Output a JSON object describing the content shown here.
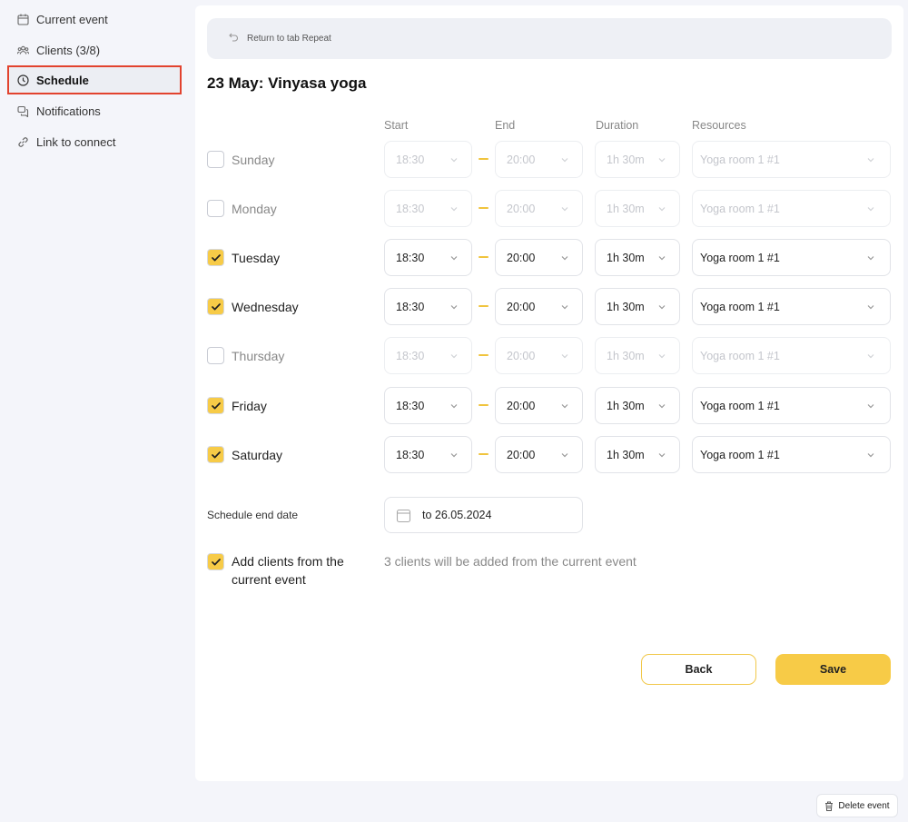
{
  "sidebar": {
    "items": [
      {
        "label": "Current event",
        "icon": "calendar-icon"
      },
      {
        "label": "Clients (3/8)",
        "icon": "users-icon"
      },
      {
        "label": "Schedule",
        "icon": "clock-icon",
        "active": true
      },
      {
        "label": "Notifications",
        "icon": "chat-icon"
      },
      {
        "label": "Link to connect",
        "icon": "link-icon"
      }
    ]
  },
  "main": {
    "return_label": "Return to tab Repeat",
    "title": "23 May: Vinyasa yoga",
    "columns": {
      "start": "Start",
      "end": "End",
      "duration": "Duration",
      "resources": "Resources"
    },
    "rows": [
      {
        "day": "Sunday",
        "checked": false,
        "start": "18:30",
        "end": "20:00",
        "duration": "1h 30m",
        "resource": "Yoga room 1 #1"
      },
      {
        "day": "Monday",
        "checked": false,
        "start": "18:30",
        "end": "20:00",
        "duration": "1h 30m",
        "resource": "Yoga room 1 #1"
      },
      {
        "day": "Tuesday",
        "checked": true,
        "start": "18:30",
        "end": "20:00",
        "duration": "1h 30m",
        "resource": "Yoga room 1 #1"
      },
      {
        "day": "Wednesday",
        "checked": true,
        "start": "18:30",
        "end": "20:00",
        "duration": "1h 30m",
        "resource": "Yoga room 1 #1"
      },
      {
        "day": "Thursday",
        "checked": false,
        "start": "18:30",
        "end": "20:00",
        "duration": "1h 30m",
        "resource": "Yoga room 1 #1"
      },
      {
        "day": "Friday",
        "checked": true,
        "start": "18:30",
        "end": "20:00",
        "duration": "1h 30m",
        "resource": "Yoga room 1 #1"
      },
      {
        "day": "Saturday",
        "checked": true,
        "start": "18:30",
        "end": "20:00",
        "duration": "1h 30m",
        "resource": "Yoga room 1 #1"
      }
    ],
    "end_date_label": "Schedule end date",
    "end_date_value": "to 26.05.2024",
    "add_clients_label": "Add clients from the current event",
    "add_clients_checked": true,
    "clients_note": "3 clients will be added from the current event",
    "back_label": "Back",
    "save_label": "Save"
  },
  "delete_label": "Delete event",
  "colors": {
    "accent": "#f7cb47",
    "active_outline": "#e2432e",
    "background": "#f4f5fa"
  }
}
